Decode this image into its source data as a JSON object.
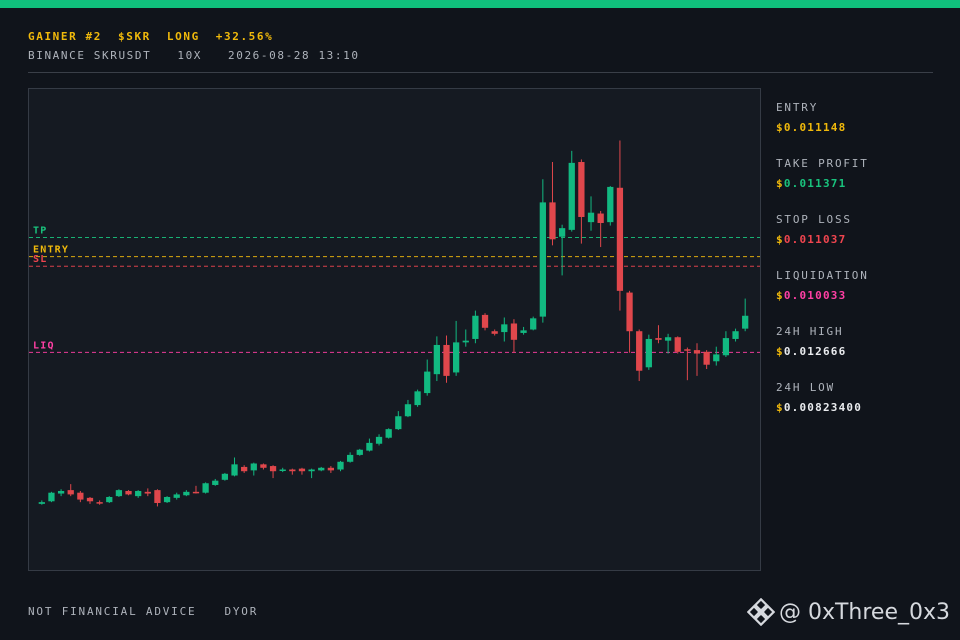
{
  "header": {
    "rank": "GAINER #2",
    "symbol": "$SKR",
    "side": "LONG",
    "change": "+32.56%",
    "exchange": "BINANCE SKRUSDT",
    "leverage": "10X",
    "timestamp": "2026-08-28 13:10"
  },
  "stats": [
    {
      "label": "ENTRY",
      "currency": "$",
      "value": "0.011148",
      "color": "#f0b90b"
    },
    {
      "label": "TAKE PROFIT",
      "currency": "$",
      "value": "0.011371",
      "color": "#19c37d"
    },
    {
      "label": "STOP LOSS",
      "currency": "$",
      "value": "0.011037",
      "color": "#f0454f"
    },
    {
      "label": "LIQUIDATION",
      "currency": "$",
      "value": "0.010033",
      "color": "#ff3fa4"
    },
    {
      "label": "24H HIGH",
      "currency": "$",
      "value": "0.012666",
      "color": "#e9ebee"
    },
    {
      "label": "24H LOW",
      "currency": "$",
      "value": "0.00823400",
      "color": "#e9ebee"
    }
  ],
  "footer": {
    "disclaimer": "NOT FINANCIAL ADVICE",
    "dyor": "DYOR",
    "handle": "@ 0xThree_0x3"
  },
  "icons": {
    "brand": "binance-logo-icon"
  },
  "colors": {
    "up": "#12b981",
    "down": "#e0474c",
    "accent": "#10c07c",
    "tp": "#19c37d",
    "entry": "#f0b90b",
    "sl": "#f0454f",
    "liq": "#ff3fa4"
  },
  "chart_data": {
    "type": "candlestick",
    "ylim": [
      0.0075,
      0.0131
    ],
    "levels": [
      {
        "label": "TP",
        "value": 0.011371,
        "color": "#19c37d"
      },
      {
        "label": "ENTRY",
        "value": 0.011148,
        "color": "#f0b90b"
      },
      {
        "label": "SL",
        "value": 0.011037,
        "color": "#f0454f"
      },
      {
        "label": "LIQ",
        "value": 0.010033,
        "color": "#ff3fa4"
      }
    ],
    "candles": [
      [
        0.00827,
        0.00829,
        0.00826,
        0.00831
      ],
      [
        0.0083,
        0.0084,
        0.00829,
        0.00841
      ],
      [
        0.00839,
        0.00842,
        0.00836,
        0.00844
      ],
      [
        0.00843,
        0.00838,
        0.00836,
        0.0085
      ],
      [
        0.0084,
        0.00832,
        0.00829,
        0.00842
      ],
      [
        0.00834,
        0.0083,
        0.00827,
        0.00835
      ],
      [
        0.00829,
        0.00828,
        0.00826,
        0.00831
      ],
      [
        0.00829,
        0.00835,
        0.00828,
        0.00836
      ],
      [
        0.00836,
        0.00843,
        0.00835,
        0.00844
      ],
      [
        0.00842,
        0.00838,
        0.00837,
        0.00843
      ],
      [
        0.00836,
        0.00842,
        0.00834,
        0.00843
      ],
      [
        0.00841,
        0.00839,
        0.00836,
        0.00845
      ],
      [
        0.00843,
        0.00828,
        0.00824,
        0.00844
      ],
      [
        0.00829,
        0.00835,
        0.00828,
        0.00836
      ],
      [
        0.00834,
        0.00838,
        0.00832,
        0.0084
      ],
      [
        0.00837,
        0.00841,
        0.00836,
        0.00843
      ],
      [
        0.00841,
        0.0084,
        0.00839,
        0.00848
      ],
      [
        0.0084,
        0.00851,
        0.00839,
        0.00852
      ],
      [
        0.00849,
        0.00854,
        0.00848,
        0.00856
      ],
      [
        0.00855,
        0.00862,
        0.00854,
        0.00863
      ],
      [
        0.0086,
        0.00873,
        0.00859,
        0.00881
      ],
      [
        0.0087,
        0.00865,
        0.00863,
        0.00872
      ],
      [
        0.00866,
        0.00874,
        0.0086,
        0.00875
      ],
      [
        0.00873,
        0.00869,
        0.00867,
        0.00874
      ],
      [
        0.00871,
        0.00865,
        0.00857,
        0.00872
      ],
      [
        0.00866,
        0.00867,
        0.00864,
        0.00869
      ],
      [
        0.00867,
        0.00865,
        0.00861,
        0.00868
      ],
      [
        0.00868,
        0.00865,
        0.00861,
        0.00869
      ],
      [
        0.00865,
        0.00867,
        0.00857,
        0.00868
      ],
      [
        0.00866,
        0.00869,
        0.00865,
        0.0087
      ],
      [
        0.00869,
        0.00866,
        0.00863,
        0.00871
      ],
      [
        0.00867,
        0.00876,
        0.00865,
        0.00877
      ],
      [
        0.00876,
        0.00884,
        0.00875,
        0.00887
      ],
      [
        0.00884,
        0.0089,
        0.00883,
        0.00891
      ],
      [
        0.00889,
        0.00898,
        0.00888,
        0.00903
      ],
      [
        0.00897,
        0.00905,
        0.00895,
        0.00908
      ],
      [
        0.00904,
        0.00914,
        0.00903,
        0.00915
      ],
      [
        0.00914,
        0.00929,
        0.00913,
        0.00935
      ],
      [
        0.00929,
        0.00943,
        0.00928,
        0.00948
      ],
      [
        0.00942,
        0.00958,
        0.0094,
        0.0096
      ],
      [
        0.00956,
        0.00981,
        0.00953,
        0.00995
      ],
      [
        0.00978,
        0.01012,
        0.0097,
        0.01022
      ],
      [
        0.01012,
        0.00976,
        0.00968,
        0.01023
      ],
      [
        0.0098,
        0.01015,
        0.00976,
        0.0104
      ],
      [
        0.01015,
        0.01017,
        0.0101,
        0.0103
      ],
      [
        0.01019,
        0.01046,
        0.01014,
        0.01052
      ],
      [
        0.01047,
        0.01032,
        0.01029,
        0.01049
      ],
      [
        0.01028,
        0.01025,
        0.01023,
        0.0103
      ],
      [
        0.01027,
        0.01036,
        0.01016,
        0.01044
      ],
      [
        0.01037,
        0.01018,
        0.01003,
        0.01042
      ],
      [
        0.01026,
        0.01029,
        0.01024,
        0.01033
      ],
      [
        0.0103,
        0.01043,
        0.01029,
        0.01045
      ],
      [
        0.01045,
        0.01178,
        0.01038,
        0.01205
      ],
      [
        0.01178,
        0.01135,
        0.01128,
        0.01225
      ],
      [
        0.01138,
        0.01148,
        0.01093,
        0.01152
      ],
      [
        0.01146,
        0.01224,
        0.01144,
        0.01238
      ],
      [
        0.01225,
        0.01161,
        0.0113,
        0.01228
      ],
      [
        0.01155,
        0.01166,
        0.01145,
        0.01185
      ],
      [
        0.01165,
        0.01154,
        0.01126,
        0.01168
      ],
      [
        0.01155,
        0.01196,
        0.01151,
        0.01197
      ],
      [
        0.01195,
        0.01075,
        0.01052,
        0.0125
      ],
      [
        0.01073,
        0.01028,
        0.01003,
        0.01075
      ],
      [
        0.01028,
        0.00982,
        0.0097,
        0.0103
      ],
      [
        0.00986,
        0.01019,
        0.00983,
        0.01024
      ],
      [
        0.0102,
        0.01018,
        0.01014,
        0.01035
      ],
      [
        0.01017,
        0.01021,
        0.01002,
        0.01025
      ],
      [
        0.01021,
        0.01004,
        0.01002,
        0.01022
      ],
      [
        0.01007,
        0.01006,
        0.00971,
        0.01009
      ],
      [
        0.01006,
        0.01002,
        0.00976,
        0.01014
      ],
      [
        0.01004,
        0.00989,
        0.00984,
        0.01006
      ],
      [
        0.00993,
        0.01001,
        0.00988,
        0.0101
      ],
      [
        0.01,
        0.0102,
        0.00998,
        0.01028
      ],
      [
        0.01019,
        0.01028,
        0.01016,
        0.01031
      ],
      [
        0.01031,
        0.01046,
        0.01028,
        0.01066
      ]
    ]
  }
}
